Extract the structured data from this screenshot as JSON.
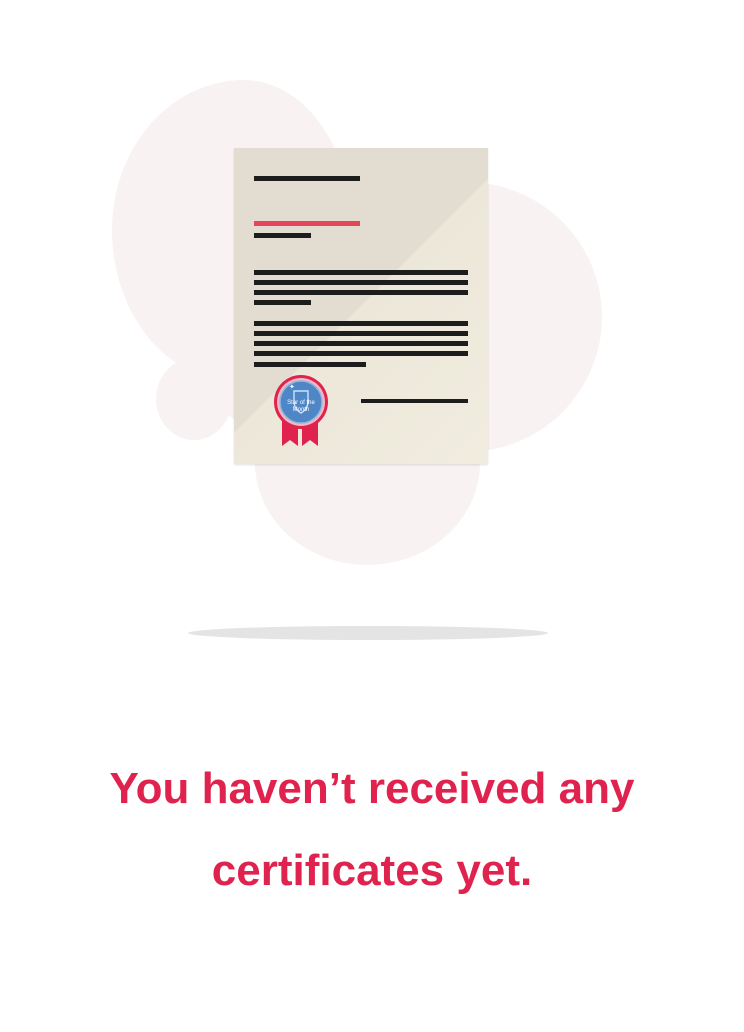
{
  "empty_state": {
    "line1": "You haven’t received any",
    "line2": "certificates yet."
  },
  "certificate_illustration": {
    "seal_text": "Star of the Month",
    "seal_colors": {
      "ribbon": "#e0234e",
      "badge": "#4f86c6"
    },
    "accent_line_color": "#e4465a"
  },
  "colors": {
    "message": "#e0234e",
    "blob": "#f8f2f2"
  }
}
